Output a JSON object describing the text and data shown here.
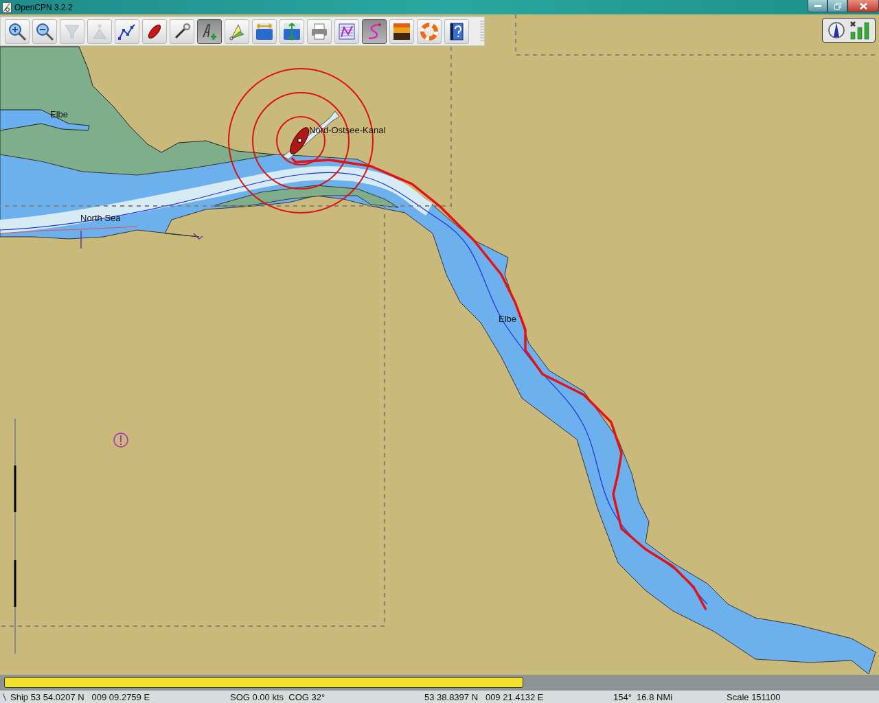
{
  "window": {
    "title": "OpenCPN 3.2.2"
  },
  "toolbar": [
    {
      "kind": "zoom_in",
      "on": false,
      "disabled": false
    },
    {
      "kind": "zoom_out",
      "on": false,
      "disabled": false
    },
    {
      "kind": "scale_down",
      "on": false,
      "disabled": true
    },
    {
      "kind": "scale_up",
      "on": false,
      "disabled": true
    },
    {
      "kind": "route",
      "on": false,
      "disabled": false
    },
    {
      "kind": "follow",
      "on": false,
      "disabled": false
    },
    {
      "kind": "settings",
      "on": false,
      "disabled": false
    },
    {
      "kind": "text",
      "on": true,
      "disabled": false
    },
    {
      "kind": "mark",
      "on": false,
      "disabled": false
    },
    {
      "kind": "tide",
      "on": false,
      "disabled": false
    },
    {
      "kind": "current",
      "on": false,
      "disabled": false
    },
    {
      "kind": "print",
      "on": false,
      "disabled": false
    },
    {
      "kind": "route_manager",
      "on": false,
      "disabled": false
    },
    {
      "kind": "track",
      "on": true,
      "disabled": false
    },
    {
      "kind": "color_scheme",
      "on": false,
      "disabled": false
    },
    {
      "kind": "mob",
      "on": false,
      "disabled": false
    },
    {
      "kind": "help",
      "on": false,
      "disabled": false
    }
  ],
  "chart": {
    "labels": [
      {
        "text": "Elbe",
        "kind": "upper_elbe"
      },
      {
        "text": "North Sea",
        "kind": "north_sea"
      },
      {
        "text": "Nord-Ostsee-Kanal",
        "kind": "canal"
      },
      {
        "text": "Elbe",
        "kind": "river"
      }
    ]
  },
  "chart_bar": {
    "level": 0.595
  },
  "status_bar": [
    "Ship 53 54.0207 N   009 09.2759 E",
    "SOG 0.00 kts  COG 32°",
    "53 38.8397 N   009 21.4132 E",
    "154°  16.8 NMi",
    "Scale 151100"
  ]
}
